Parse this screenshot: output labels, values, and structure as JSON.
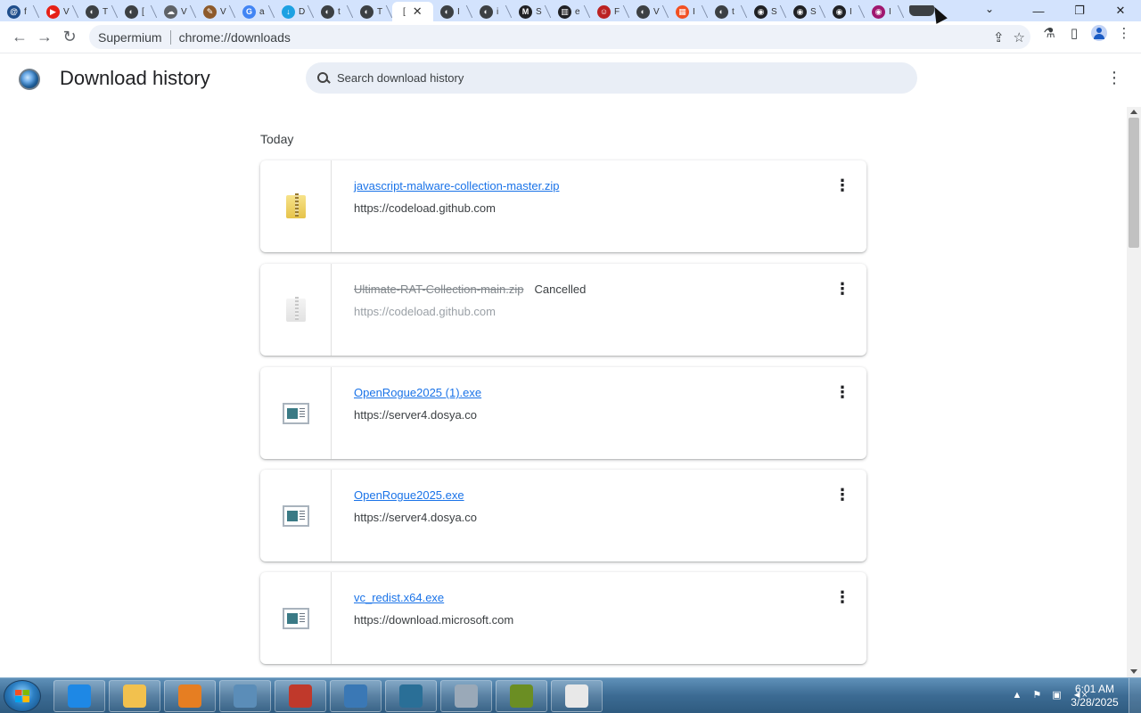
{
  "browser": {
    "tabs": [
      {
        "glyph": "@",
        "label": "f",
        "color": "#1f4e8c"
      },
      {
        "glyph": "▶",
        "label": "V",
        "color": "#e62117"
      },
      {
        "glyph": "◐",
        "label": "T",
        "color": "#3c4043"
      },
      {
        "glyph": "◐",
        "label": "[",
        "color": "#3c4043"
      },
      {
        "glyph": "☁",
        "label": "V",
        "color": "#5f6368"
      },
      {
        "glyph": "✎",
        "label": "V",
        "color": "#8d5a2b"
      },
      {
        "glyph": "G",
        "label": "a",
        "color": "#4285f4"
      },
      {
        "glyph": "↓",
        "label": "D",
        "color": "#1da1e2"
      },
      {
        "glyph": "◐",
        "label": "t",
        "color": "#3c4043"
      },
      {
        "glyph": "◐",
        "label": "T",
        "color": "#3c4043"
      },
      {
        "glyph": "",
        "label": "[",
        "color": "#ffffff",
        "active": true
      },
      {
        "glyph": "◐",
        "label": "I",
        "color": "#3c4043"
      },
      {
        "glyph": "◐",
        "label": "i",
        "color": "#3c4043"
      },
      {
        "glyph": "M",
        "label": "S",
        "color": "#202124"
      },
      {
        "glyph": "▥",
        "label": "e",
        "color": "#202124"
      },
      {
        "glyph": "☺",
        "label": "F",
        "color": "#b22"
      },
      {
        "glyph": "◐",
        "label": "V",
        "color": "#3c4043"
      },
      {
        "glyph": "▦",
        "label": "I",
        "color": "#f25022"
      },
      {
        "glyph": "◐",
        "label": "t",
        "color": "#3c4043"
      },
      {
        "glyph": "◉",
        "label": "S",
        "color": "#202124"
      },
      {
        "glyph": "◉",
        "label": "S",
        "color": "#202124"
      },
      {
        "glyph": "◉",
        "label": "I",
        "color": "#202124"
      },
      {
        "glyph": "◉",
        "label": "I",
        "color": "#a0176f"
      }
    ],
    "omnibox": {
      "site": "Supermium",
      "url": "chrome://downloads"
    }
  },
  "page": {
    "title": "Download history",
    "search_placeholder": "Search download history",
    "section": "Today"
  },
  "downloads": [
    {
      "name": "javascript-malware-collection-master.zip",
      "url": "https://codeload.github.com",
      "status": "",
      "type": "zip",
      "cancelled": false
    },
    {
      "name": "Ultimate-RAT-Collection-main.zip",
      "url": "https://codeload.github.com",
      "status": "Cancelled",
      "type": "zip",
      "cancelled": true
    },
    {
      "name": "OpenRogue2025 (1).exe",
      "url": "https://server4.dosya.co",
      "status": "",
      "type": "exe",
      "cancelled": false
    },
    {
      "name": "OpenRogue2025.exe",
      "url": "https://server4.dosya.co",
      "status": "",
      "type": "exe",
      "cancelled": false
    },
    {
      "name": "vc_redist.x64.exe",
      "url": "https://download.microsoft.com",
      "status": "",
      "type": "exe",
      "cancelled": false
    }
  ],
  "taskbar": {
    "buttons": [
      "internet-explorer",
      "file-explorer",
      "media-player",
      "control-panel",
      "toolbox",
      "network",
      "supermium-browser",
      "mobile-device",
      "spy-tool",
      "document"
    ],
    "time": "6:01 AM",
    "date": "3/28/2025"
  }
}
